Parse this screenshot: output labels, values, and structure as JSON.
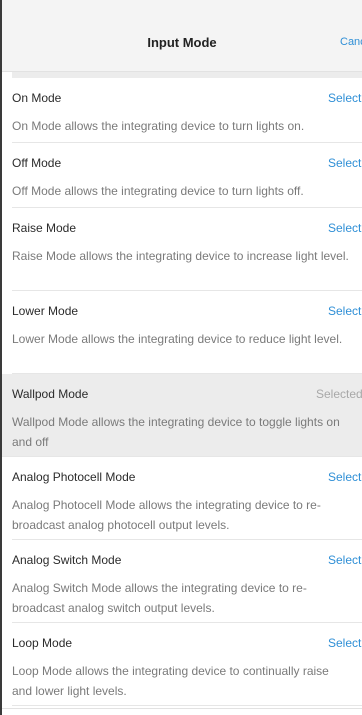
{
  "header": {
    "title": "Input Mode",
    "cancel_label": "Cancel"
  },
  "modes": [
    {
      "title": "On Mode",
      "action": "Select",
      "description": "On Mode allows the integrating device to turn lights on."
    },
    {
      "title": "Off Mode",
      "action": "Select",
      "description": "Off Mode allows the integrating device to turn lights off."
    },
    {
      "title": "Raise Mode",
      "action": "Select",
      "description": "Raise Mode allows the integrating device to increase light level."
    },
    {
      "title": "Lower Mode",
      "action": "Select",
      "description": "Lower Mode allows the integrating device to reduce light level."
    },
    {
      "title": "Wallpod Mode",
      "action": "Selected",
      "description": "Wallpod Mode allows the integrating device to toggle lights on and off"
    },
    {
      "title": "Analog Photocell Mode",
      "action": "Select",
      "description": "Analog Photocell Mode allows the integrating device to re-broadcast analog photocell output levels."
    },
    {
      "title": "Analog Switch Mode",
      "action": "Select",
      "description": "Analog Switch Mode allows the integrating device to re-broadcast analog switch output levels."
    },
    {
      "title": "Loop Mode",
      "action": "Select",
      "description": "Loop Mode allows the integrating device to continually raise and lower light levels."
    }
  ],
  "colors": {
    "accent": "#2f8fd6",
    "selected_background": "#ececec",
    "selected_text": "#a8a8a8"
  }
}
